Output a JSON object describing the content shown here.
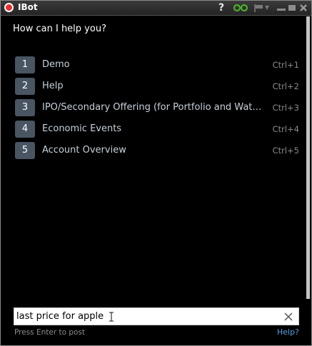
{
  "window": {
    "title": "IBot",
    "help_glyph": "?",
    "icons": [
      "ibot-app-icon",
      "link-icon",
      "flag-icon",
      "dropdown-caret-icon",
      "minimize-icon",
      "maximize-icon",
      "close-icon"
    ],
    "accent_colors": {
      "link_icon": "#4caf2a",
      "app_icon": "#e33030",
      "help_link": "#5aa0e0",
      "option_badge": "#4a5563"
    }
  },
  "chat": {
    "greeting": "How can I help you?"
  },
  "options": [
    {
      "number": "1",
      "label": "Demo",
      "shortcut": "Ctrl+1"
    },
    {
      "number": "2",
      "label": "Help",
      "shortcut": "Ctrl+2"
    },
    {
      "number": "3",
      "label": "IPO/Secondary Offering (for Portfolio and Watchlists)",
      "shortcut": "Ctrl+3"
    },
    {
      "number": "4",
      "label": "Economic Events",
      "shortcut": "Ctrl+4"
    },
    {
      "number": "5",
      "label": "Account Overview",
      "shortcut": "Ctrl+5"
    }
  ],
  "input": {
    "value": "last price for apple",
    "placeholder": "",
    "clear_icon": "clear-x-icon"
  },
  "footer": {
    "hint": "Press Enter to post",
    "help_link": "Help?"
  }
}
